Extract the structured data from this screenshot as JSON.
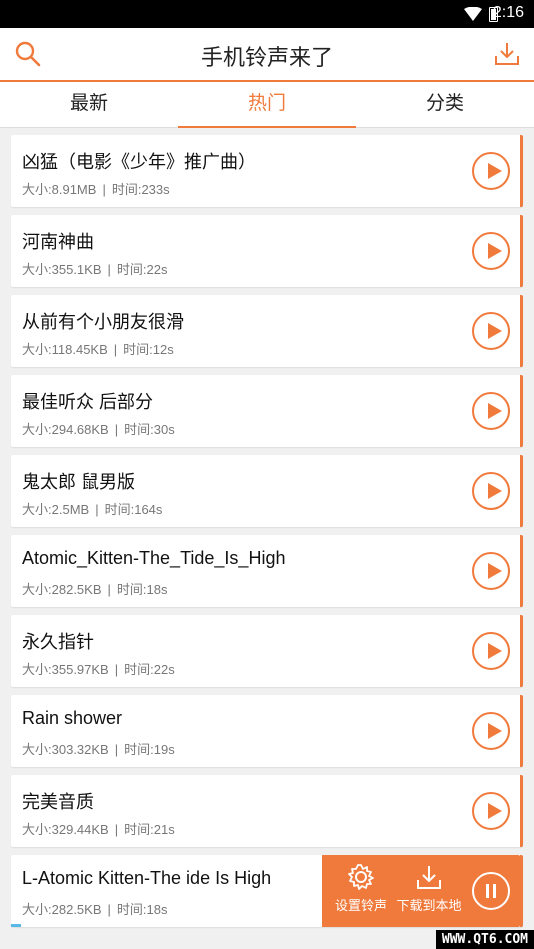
{
  "status_bar": {
    "time": "2:16"
  },
  "header": {
    "title": "手机铃声来了",
    "search_icon": "search-icon",
    "download_icon": "download-icon"
  },
  "tabs": [
    {
      "label": "最新",
      "active": false
    },
    {
      "label": "热门",
      "active": true
    },
    {
      "label": "分类",
      "active": false
    }
  ],
  "size_prefix": "大小:",
  "time_prefix": "时间:",
  "songs": [
    {
      "name": "凶猛（电影《少年》推广曲）",
      "size": "8.91MB",
      "duration": "233s"
    },
    {
      "name": "河南神曲",
      "size": "355.1KB",
      "duration": "22s"
    },
    {
      "name": "从前有个小朋友很滑",
      "size": "118.45KB",
      "duration": "12s"
    },
    {
      "name": "最佳听众 后部分",
      "size": "294.68KB",
      "duration": "30s"
    },
    {
      "name": "鬼太郎 鼠男版",
      "size": "2.5MB",
      "duration": "164s"
    },
    {
      "name": "Atomic_Kitten-The_Tide_Is_High",
      "size": "282.5KB",
      "duration": "18s"
    },
    {
      "name": "永久指针",
      "size": "355.97KB",
      "duration": "22s"
    },
    {
      "name": "Rain shower",
      "size": "303.32KB",
      "duration": "19s"
    },
    {
      "name": "完美音质",
      "size": "329.44KB",
      "duration": "21s"
    },
    {
      "name": "L-Atomic Kitten-The ide Is High",
      "size": "282.5KB",
      "duration": "18s",
      "playing": true,
      "progress": 0.02
    }
  ],
  "playing_actions": {
    "set_ringtone": "设置铃声",
    "download_local": "下载到本地"
  },
  "watermark": "WWW.QT6.COM",
  "colors": {
    "accent": "#f07a3c",
    "progress": "#59b8e8"
  }
}
